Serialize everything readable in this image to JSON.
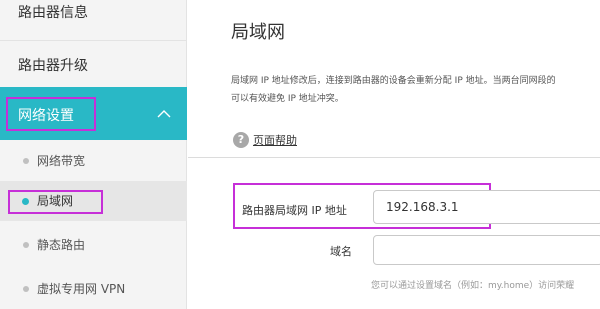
{
  "sidebar": {
    "items": [
      {
        "label": "路由器信息"
      },
      {
        "label": "路由器升级"
      },
      {
        "label": "网络设置"
      }
    ],
    "sub_items": [
      {
        "label": "网络带宽"
      },
      {
        "label": "局域网"
      },
      {
        "label": "静态路由"
      },
      {
        "label": "虚拟专用网 VPN"
      }
    ]
  },
  "main": {
    "title": "局域网",
    "description_line1": "局域网 IP 地址修改后，连接到路由器的设备会重新分配 IP 地址。当两台同网段的",
    "description_line2": "可以有效避免 IP 地址冲突。",
    "help_link": "页面帮助",
    "fields": {
      "ip_label": "路由器局域网 IP 地址",
      "ip_value": "192.168.3.1",
      "domain_label": "域名",
      "domain_value": "",
      "domain_hint": "您可以通过设置域名（例如：my.home）访问荣耀"
    }
  },
  "colors": {
    "accent": "#29b8c6",
    "highlight_box": "#c62fd8",
    "sidebar_bg": "#f4f4f4"
  },
  "icons": [
    "chevron-up-icon",
    "help-icon",
    "bullet-dot-icon"
  ]
}
